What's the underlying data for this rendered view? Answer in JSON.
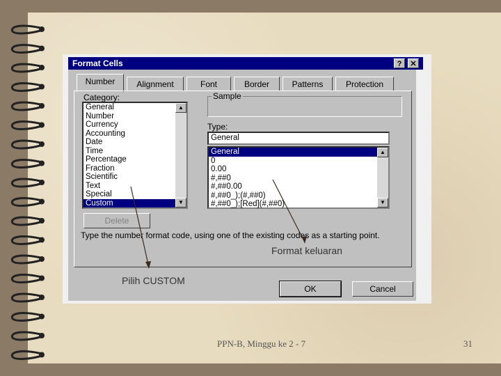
{
  "dialog": {
    "title": "Format Cells",
    "help_glyph": "?",
    "close_glyph": "✕",
    "tabs": [
      "Number",
      "Alignment",
      "Font",
      "Border",
      "Patterns",
      "Protection"
    ],
    "category_label": "Category:",
    "categories": [
      "General",
      "Number",
      "Currency",
      "Accounting",
      "Date",
      "Time",
      "Percentage",
      "Fraction",
      "Scientific",
      "Text",
      "Special",
      "Custom"
    ],
    "selected_category": "Custom",
    "sample_label": "Sample",
    "type_label": "Type:",
    "type_value": "General",
    "formats": [
      "General",
      "0",
      "0.00",
      "#,##0",
      "#,##0.00",
      "#,##0_);(#,##0)",
      "#,##0_);[Red](#,##0)"
    ],
    "selected_format": "General",
    "delete_label": "Delete",
    "hint": "Type the number format code, using one of the existing codes as a starting point.",
    "ok_label": "OK",
    "cancel_label": "Cancel"
  },
  "annotations": {
    "format_keluaran": "Format keluaran",
    "pilih_custom": "Pilih CUSTOM"
  },
  "footer": {
    "center": "PPN-B, Minggu ke 2 - 7",
    "page_number": "31"
  }
}
